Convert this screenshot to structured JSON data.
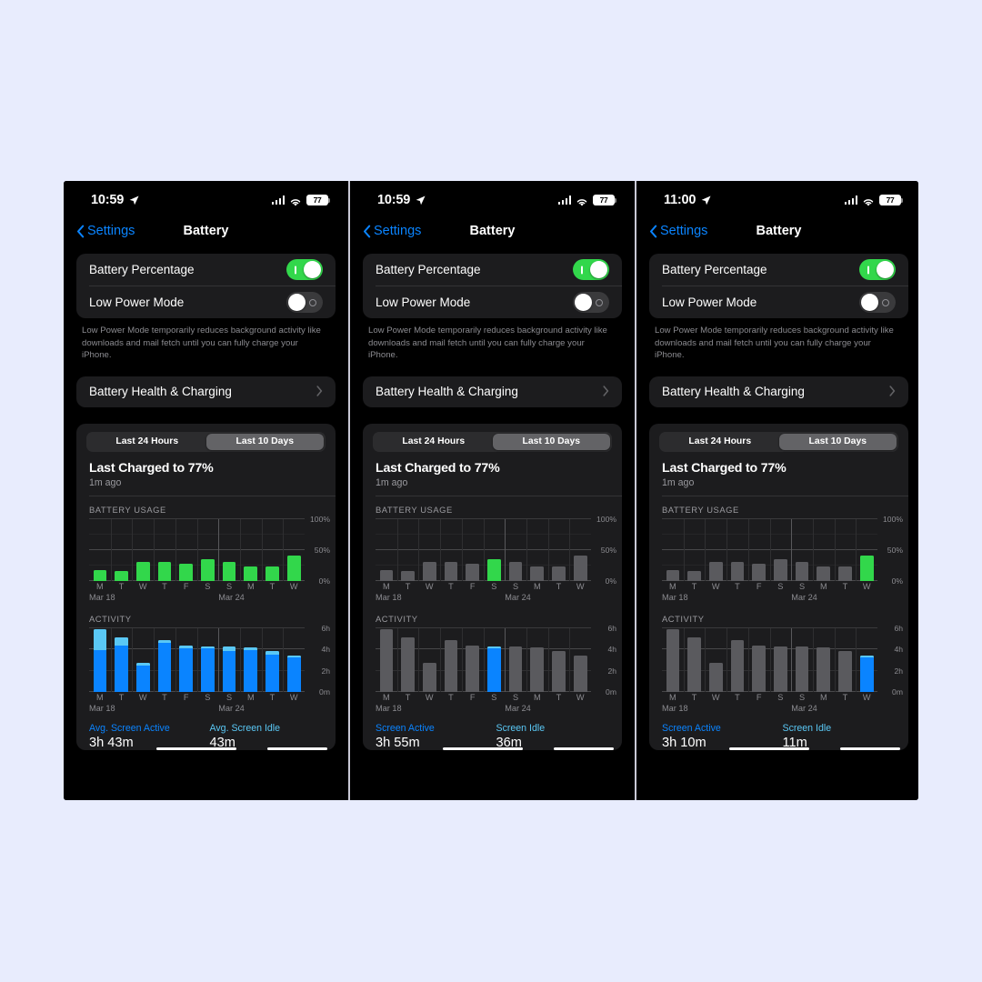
{
  "background_color": "#e8ecfd",
  "panels": [
    {
      "status": {
        "time": "10:59",
        "battery_percent": "77",
        "icons": [
          "location-arrow-icon",
          "cellular-signal-icon",
          "wifi-icon",
          "battery-icon"
        ]
      },
      "nav": {
        "back_label": "Settings",
        "title": "Battery"
      },
      "settings": {
        "battery_percentage_label": "Battery Percentage",
        "battery_percentage_state": "on",
        "low_power_mode_label": "Low Power Mode",
        "low_power_mode_state": "off",
        "footnote": "Low Power Mode temporarily reduces background activity like downloads and mail fetch until you can fully charge your iPhone.",
        "health_label": "Battery Health & Charging"
      },
      "segmented": {
        "options": [
          "Last 24 Hours",
          "Last 10 Days"
        ],
        "selected": "Last 10 Days"
      },
      "charged": {
        "title": "Last Charged to 77%",
        "subtitle": "1m ago"
      },
      "usage_header": "BATTERY USAGE",
      "activity_header": "ACTIVITY",
      "legend": {
        "active_label": "Avg. Screen Active",
        "active_value": "3h 43m",
        "idle_label": "Avg. Screen Idle",
        "idle_value": "43m"
      },
      "chart_data": [
        {
          "type": "bar",
          "title": "BATTERY USAGE",
          "categories": [
            "M",
            "T",
            "W",
            "T",
            "F",
            "S",
            "S",
            "M",
            "T",
            "W"
          ],
          "values": [
            17,
            16,
            30,
            30,
            27,
            35,
            31,
            23,
            24,
            41
          ],
          "highlight_index": null,
          "bar_color": "#32d74b",
          "dim_color": "#5a5a5e",
          "ylabel": "",
          "ylim": [
            0,
            100
          ],
          "yticks": [
            0,
            50,
            100
          ],
          "ytick_labels": [
            "0%",
            "50%",
            "100%"
          ],
          "date_labels": [
            "Mar 18",
            "Mar 24"
          ],
          "grid": true
        },
        {
          "type": "bar",
          "title": "ACTIVITY",
          "categories": [
            "M",
            "T",
            "W",
            "T",
            "F",
            "S",
            "S",
            "M",
            "T",
            "W"
          ],
          "series": [
            {
              "name": "Screen Active",
              "color": "#0a84ff",
              "values": [
                3.9,
                4.4,
                2.5,
                4.6,
                4.1,
                4.1,
                3.85,
                3.95,
                3.5,
                3.25
              ]
            },
            {
              "name": "Screen Idle",
              "color": "#5ac8f5",
              "values": [
                2.0,
                0.75,
                0.25,
                0.25,
                0.3,
                0.15,
                0.45,
                0.2,
                0.35,
                0.15
              ]
            }
          ],
          "highlight_index": null,
          "dim_color": "#5a5a5e",
          "ylim": [
            0,
            6
          ],
          "yticks": [
            0,
            2,
            4,
            6
          ],
          "ytick_labels": [
            "0m",
            "2h",
            "4h",
            "6h"
          ],
          "date_labels": [
            "Mar 18",
            "Mar 24"
          ],
          "grid": true,
          "stacked": true
        }
      ]
    },
    {
      "status": {
        "time": "10:59",
        "battery_percent": "77",
        "icons": [
          "location-arrow-icon",
          "cellular-signal-icon",
          "wifi-icon",
          "battery-icon"
        ]
      },
      "nav": {
        "back_label": "Settings",
        "title": "Battery"
      },
      "settings": {
        "battery_percentage_label": "Battery Percentage",
        "battery_percentage_state": "on",
        "low_power_mode_label": "Low Power Mode",
        "low_power_mode_state": "off",
        "footnote": "Low Power Mode temporarily reduces background activity like downloads and mail fetch until you can fully charge your iPhone.",
        "health_label": "Battery Health & Charging"
      },
      "segmented": {
        "options": [
          "Last 24 Hours",
          "Last 10 Days"
        ],
        "selected": "Last 10 Days"
      },
      "charged": {
        "title": "Last Charged to 77%",
        "subtitle": "1m ago"
      },
      "usage_header": "BATTERY USAGE",
      "activity_header": "ACTIVITY",
      "legend": {
        "active_label": "Screen Active",
        "active_value": "3h 55m",
        "idle_label": "Screen Idle",
        "idle_value": "36m"
      },
      "chart_data": [
        {
          "type": "bar",
          "title": "BATTERY USAGE",
          "categories": [
            "M",
            "T",
            "W",
            "T",
            "F",
            "S",
            "S",
            "M",
            "T",
            "W"
          ],
          "values": [
            17,
            16,
            30,
            30,
            27,
            35,
            31,
            23,
            24,
            41
          ],
          "highlight_index": 5,
          "bar_color": "#32d74b",
          "dim_color": "#5a5a5e",
          "ylim": [
            0,
            100
          ],
          "yticks": [
            0,
            50,
            100
          ],
          "ytick_labels": [
            "0%",
            "50%",
            "100%"
          ],
          "date_labels": [
            "Mar 18",
            "Mar 24"
          ],
          "grid": true
        },
        {
          "type": "bar",
          "title": "ACTIVITY",
          "categories": [
            "M",
            "T",
            "W",
            "T",
            "F",
            "S",
            "S",
            "M",
            "T",
            "W"
          ],
          "series": [
            {
              "name": "Screen Active",
              "color": "#0a84ff",
              "values": [
                3.9,
                4.4,
                2.5,
                4.6,
                4.1,
                4.1,
                3.85,
                3.95,
                3.5,
                3.25
              ]
            },
            {
              "name": "Screen Idle",
              "color": "#5ac8f5",
              "values": [
                2.0,
                0.75,
                0.25,
                0.25,
                0.3,
                0.15,
                0.45,
                0.2,
                0.35,
                0.15
              ]
            }
          ],
          "highlight_index": 5,
          "dim_color": "#5a5a5e",
          "ylim": [
            0,
            6
          ],
          "yticks": [
            0,
            2,
            4,
            6
          ],
          "ytick_labels": [
            "0m",
            "2h",
            "4h",
            "6h"
          ],
          "date_labels": [
            "Mar 18",
            "Mar 24"
          ],
          "grid": true,
          "stacked": true
        }
      ]
    },
    {
      "status": {
        "time": "11:00",
        "battery_percent": "77",
        "icons": [
          "location-arrow-icon",
          "cellular-signal-icon",
          "wifi-icon",
          "battery-icon"
        ]
      },
      "nav": {
        "back_label": "Settings",
        "title": "Battery"
      },
      "settings": {
        "battery_percentage_label": "Battery Percentage",
        "battery_percentage_state": "on",
        "low_power_mode_label": "Low Power Mode",
        "low_power_mode_state": "off",
        "footnote": "Low Power Mode temporarily reduces background activity like downloads and mail fetch until you can fully charge your iPhone.",
        "health_label": "Battery Health & Charging"
      },
      "segmented": {
        "options": [
          "Last 24 Hours",
          "Last 10 Days"
        ],
        "selected": "Last 10 Days"
      },
      "charged": {
        "title": "Last Charged to 77%",
        "subtitle": "1m ago"
      },
      "usage_header": "BATTERY USAGE",
      "activity_header": "ACTIVITY",
      "legend": {
        "active_label": "Screen Active",
        "active_value": "3h 10m",
        "idle_label": "Screen Idle",
        "idle_value": "11m"
      },
      "chart_data": [
        {
          "type": "bar",
          "title": "BATTERY USAGE",
          "categories": [
            "M",
            "T",
            "W",
            "T",
            "F",
            "S",
            "S",
            "M",
            "T",
            "W"
          ],
          "values": [
            17,
            16,
            30,
            30,
            27,
            35,
            31,
            23,
            24,
            41
          ],
          "highlight_index": 9,
          "bar_color": "#32d74b",
          "dim_color": "#5a5a5e",
          "ylim": [
            0,
            100
          ],
          "yticks": [
            0,
            50,
            100
          ],
          "ytick_labels": [
            "0%",
            "50%",
            "100%"
          ],
          "date_labels": [
            "Mar 18",
            "Mar 24"
          ],
          "grid": true
        },
        {
          "type": "bar",
          "title": "ACTIVITY",
          "categories": [
            "M",
            "T",
            "W",
            "T",
            "F",
            "S",
            "S",
            "M",
            "T",
            "W"
          ],
          "series": [
            {
              "name": "Screen Active",
              "color": "#0a84ff",
              "values": [
                3.9,
                4.4,
                2.5,
                4.6,
                4.1,
                4.1,
                3.85,
                3.95,
                3.5,
                3.25
              ]
            },
            {
              "name": "Screen Idle",
              "color": "#5ac8f5",
              "values": [
                2.0,
                0.75,
                0.25,
                0.25,
                0.3,
                0.15,
                0.45,
                0.2,
                0.35,
                0.15
              ]
            }
          ],
          "highlight_index": 9,
          "dim_color": "#5a5a5e",
          "ylim": [
            0,
            6
          ],
          "yticks": [
            0,
            2,
            4,
            6
          ],
          "ytick_labels": [
            "0m",
            "2h",
            "4h",
            "6h"
          ],
          "date_labels": [
            "Mar 18",
            "Mar 24"
          ],
          "grid": true,
          "stacked": true
        }
      ]
    }
  ]
}
